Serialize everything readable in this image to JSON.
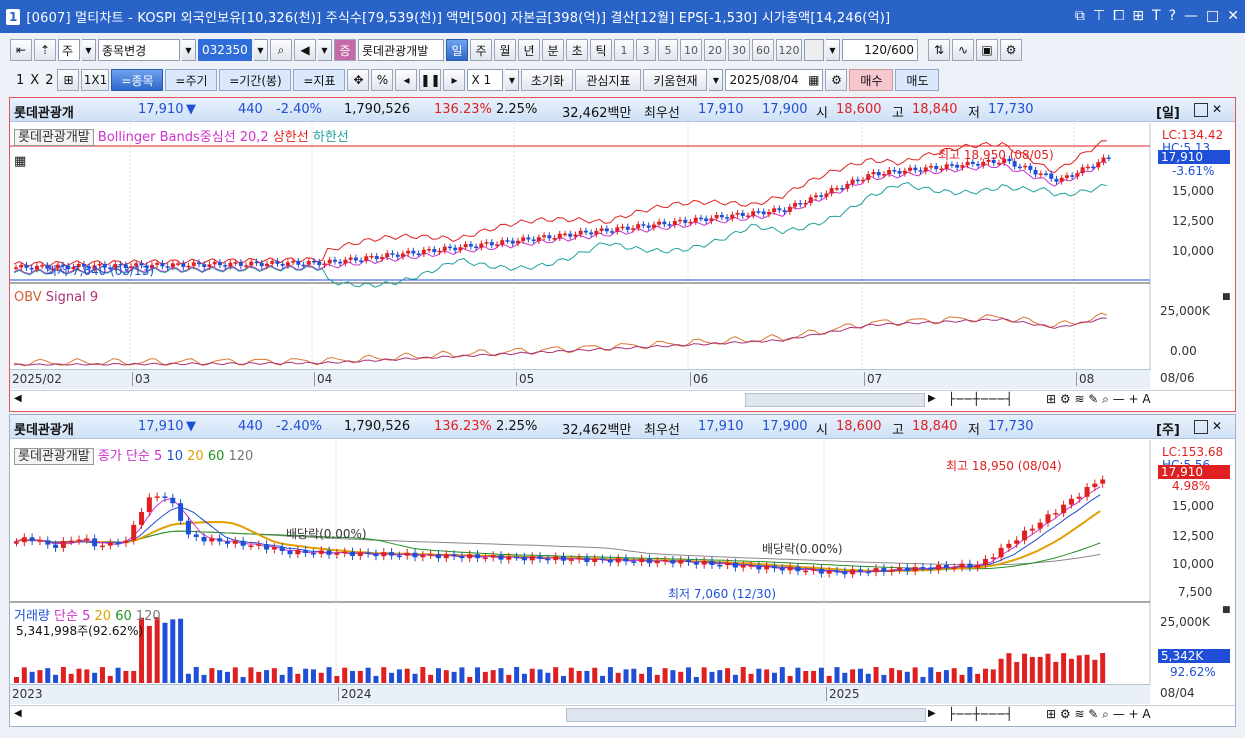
{
  "title": {
    "num": "1",
    "text": "[0607] 멀티차트 - KOSPI 외국인보유[10,326(천)] 주식수[79,539(천)] 액면[500] 자본금[398(억)] 결산[12월] EPS[-1,530] 시가총액[14,246(억)]"
  },
  "toolbar1": {
    "period_sel": "주",
    "change_stock": "종목변경",
    "code": "032350",
    "stock_name": "롯데관광개발",
    "periods": [
      "일",
      "주",
      "월",
      "년",
      "분",
      "초",
      "틱"
    ],
    "nums": [
      "1",
      "3",
      "5",
      "10",
      "20",
      "30",
      "60",
      "120"
    ],
    "count": "120",
    "total": "/600"
  },
  "toolbar2": {
    "layout": [
      "1",
      "X",
      "2"
    ],
    "one_by_one": "1X1",
    "stock_btn": "=종목",
    "period_btn": "=주기",
    "range_btn": "=기간(봉)",
    "indicator_btn": "=지표",
    "multiplier": "X 1",
    "reset": "초기화",
    "interest": "관심지표",
    "kiwoom": "키움현재",
    "date": "2025/08/04",
    "buy": "매수",
    "sell": "매도"
  },
  "colors": {
    "up": "#e02020",
    "down": "#1f4fd6",
    "accent": "#2a63c7"
  },
  "panel1": {
    "info": {
      "name": "롯데관광개",
      "price": "17,910",
      "arrow": "▼",
      "change": "440",
      "pct": "-2.40%",
      "volume": "1,790,526",
      "ratio": "136.23%",
      "turnover": "2.25%",
      "amount": "32,462백만",
      "bid_label": "최우선",
      "bid1": "17,910",
      "bid2": "17,900",
      "open_l": "시",
      "open": "18,600",
      "high_l": "고",
      "high": "18,840",
      "low_l": "저",
      "low": "17,730",
      "period": "[일]"
    },
    "price": {
      "name": "롯데관광개발",
      "bb": "Bollinger Bands중심선 20,2",
      "upper": "상한선",
      "lower": "하한선",
      "max_label": "최고 18,950 (08/05)",
      "min_label": "최저 7,640 (03/13)",
      "lc": "LC:134.42",
      "hc": "HC:5.13",
      "cur": "17,910",
      "chg": "-3.61%",
      "ticks": [
        "15,000",
        "12,500",
        "10,000"
      ]
    },
    "obv": {
      "name": "OBV",
      "signal": "Signal 9",
      "ticks": [
        "25,000K",
        "0.00"
      ]
    },
    "xaxis": [
      "2025/02",
      "03",
      "04",
      "05",
      "06",
      "07",
      "08"
    ],
    "xend": "08/06"
  },
  "panel2": {
    "info": {
      "name": "롯데관광개",
      "price": "17,910",
      "arrow": "▼",
      "change": "440",
      "pct": "-2.40%",
      "volume": "1,790,526",
      "ratio": "136.23%",
      "turnover": "2.25%",
      "amount": "32,462백만",
      "bid_label": "최우선",
      "bid1": "17,910",
      "bid2": "17,900",
      "open_l": "시",
      "open": "18,600",
      "high_l": "고",
      "high": "18,840",
      "low_l": "저",
      "low": "17,730",
      "period": "[주]"
    },
    "price": {
      "name": "롯데관광개발",
      "ma": "종가 단순 5",
      "m10": "10",
      "m20": "20",
      "m60": "60",
      "m120": "120",
      "max_label": "최고 18,950 (08/04)",
      "min_label": "최저 7,060 (12/30)",
      "div1": "배당락(0.00%)",
      "div2": "배당락(0.00%)",
      "lc": "LC:153.68",
      "hc": "HC:5.56",
      "cur": "17,910",
      "chg": "4.98%",
      "ticks": [
        "15,000",
        "12,500",
        "10,000",
        "7,500"
      ]
    },
    "vol": {
      "name": "거래량",
      "ma": "단순 5",
      "m20": "20",
      "m60": "60",
      "m120": "120",
      "sub": "5,341,998주(92.62%)",
      "ticks": [
        "25,000K"
      ],
      "cur": "5,342K",
      "pct": "92.62%"
    },
    "xaxis": [
      "2023",
      "2024",
      "2025"
    ],
    "xend": "08/04"
  }
}
